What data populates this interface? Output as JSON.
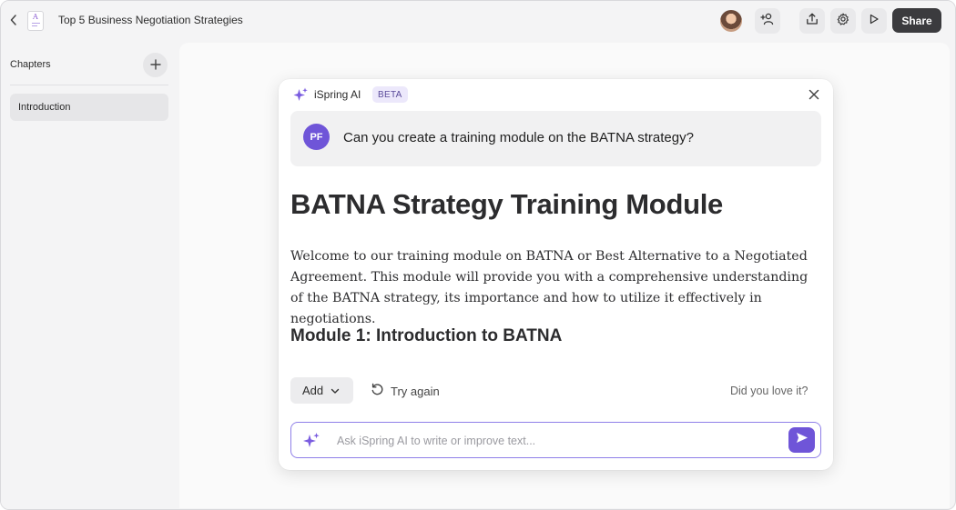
{
  "header": {
    "document_title": "Top 5 Business Negotiation Strategies",
    "doc_icon_letter": "A",
    "share_label": "Share",
    "icons": [
      "chevron-left-icon",
      "document-icon",
      "user-avatar",
      "add-user-icon",
      "upload-icon",
      "gear-icon",
      "play-icon"
    ]
  },
  "sidebar": {
    "title": "Chapters",
    "items": [
      {
        "label": "Introduction",
        "selected": true
      }
    ]
  },
  "ai_dialog": {
    "title": "iSpring AI",
    "badge": "BETA",
    "user_initials": "PF",
    "user_prompt": "Can you create a training module on the BATNA strategy?",
    "response": {
      "title": "BATNA Strategy Training Module",
      "paragraph": "Welcome to our training module on BATNA or Best Alternative to a Negotiated Agreement. This module will provide you with a comprehensive understanding of the BATNA strategy, its importance and how to utilize it effectively in negotiations.",
      "subtitle": "Module 1: Introduction to BATNA"
    },
    "actions": {
      "add_label": "Add",
      "try_again_label": "Try again",
      "feedback_label": "Did you love it?"
    },
    "input": {
      "placeholder": "Ask iSpring AI to write or improve text...",
      "value": ""
    }
  },
  "colors": {
    "accent": "#6f55d8",
    "share_button": "#3b3b3e",
    "input_border": "#8f7fe8"
  }
}
